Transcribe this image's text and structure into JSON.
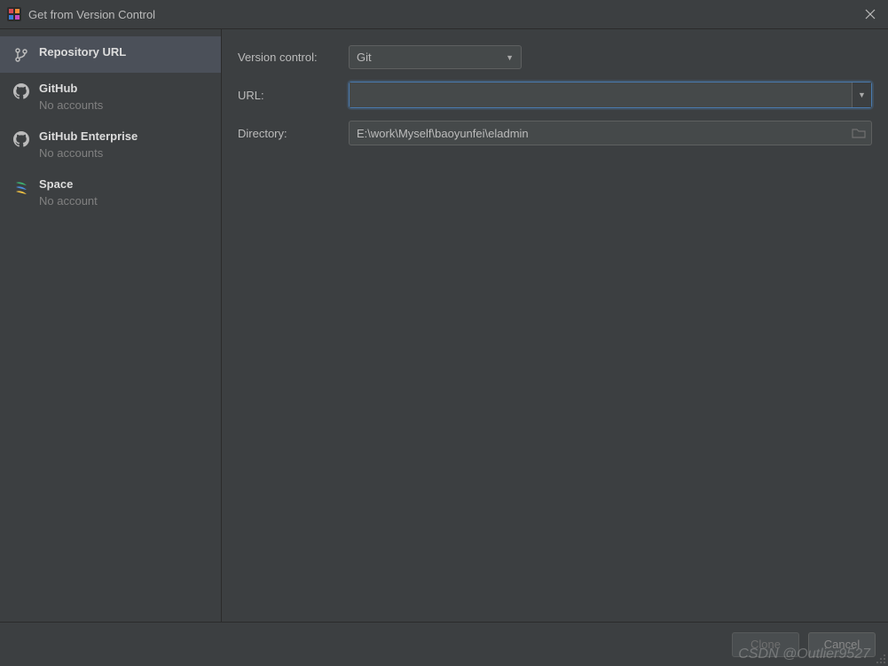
{
  "window": {
    "title": "Get from Version Control"
  },
  "sidebar": {
    "items": [
      {
        "label": "Repository URL",
        "sub": ""
      },
      {
        "label": "GitHub",
        "sub": "No accounts"
      },
      {
        "label": "GitHub Enterprise",
        "sub": "No accounts"
      },
      {
        "label": "Space",
        "sub": "No account"
      }
    ]
  },
  "form": {
    "version_control_label": "Version control:",
    "version_control_value": "Git",
    "url_label": "URL:",
    "url_value": "",
    "directory_label": "Directory:",
    "directory_value": "E:\\work\\Myself\\baoyunfei\\eladmin"
  },
  "footer": {
    "clone_label": "Clone",
    "cancel_label": "Cancel"
  },
  "watermark": "CSDN @Outlier9527"
}
